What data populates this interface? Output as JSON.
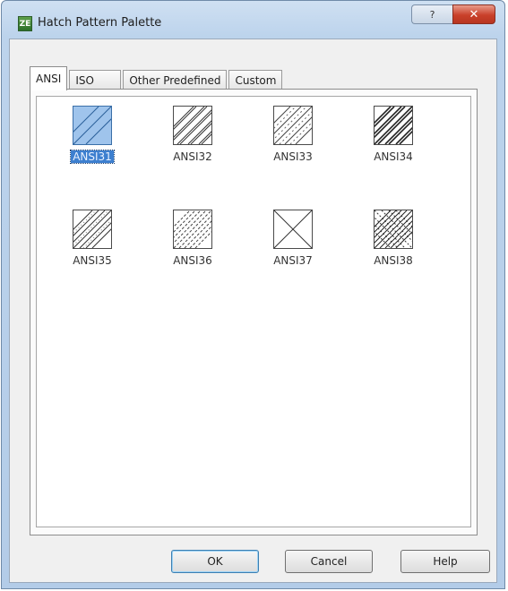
{
  "window": {
    "title": "Hatch Pattern Palette",
    "app_icon_text": "ZE",
    "help_caption_glyph": "?",
    "close_caption_glyph": "✕"
  },
  "tabs": [
    {
      "label": "ANSI",
      "active": true
    },
    {
      "label": "ISO",
      "active": false
    },
    {
      "label": "Other Predefined",
      "active": false
    },
    {
      "label": "Custom",
      "active": false
    }
  ],
  "patterns": [
    {
      "label": "ANSI31",
      "selected": true,
      "icon": "diagonal-hatch-icon"
    },
    {
      "label": "ANSI32",
      "selected": false,
      "icon": "double-diagonal-hatch-icon"
    },
    {
      "label": "ANSI33",
      "selected": false,
      "icon": "dash-diagonal-hatch-icon"
    },
    {
      "label": "ANSI34",
      "selected": false,
      "icon": "dense-diagonal-hatch-icon"
    },
    {
      "label": "ANSI35",
      "selected": false,
      "icon": "alternating-diagonal-hatch-icon"
    },
    {
      "label": "ANSI36",
      "selected": false,
      "icon": "dashed-diagonal-hatch-icon"
    },
    {
      "label": "ANSI37",
      "selected": false,
      "icon": "cross-hatch-icon"
    },
    {
      "label": "ANSI38",
      "selected": false,
      "icon": "dense-cross-hatch-icon"
    }
  ],
  "buttons": {
    "ok": "OK",
    "cancel": "Cancel",
    "help": "Help"
  },
  "colors": {
    "selection": "#3d7fcf",
    "selected_swatch": "#9fc4ec"
  }
}
